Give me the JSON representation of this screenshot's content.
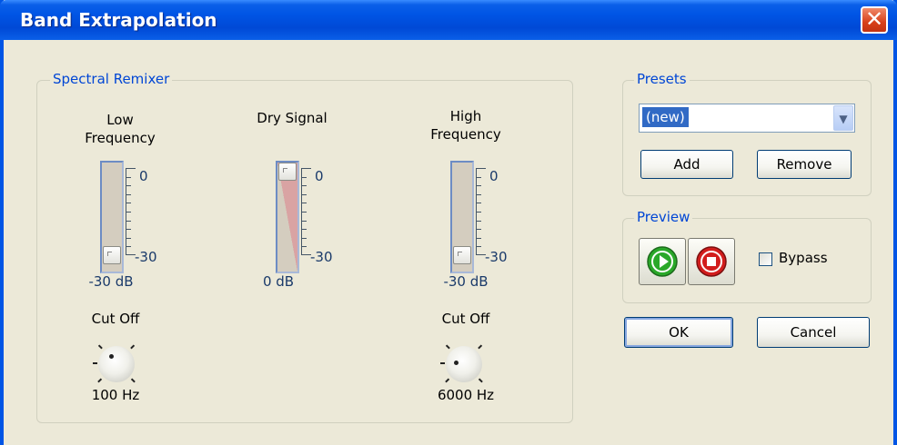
{
  "window": {
    "title": "Band Extrapolation",
    "close_symbol": "✕"
  },
  "spectral_remixer": {
    "legend": "Spectral Remixer",
    "low": {
      "label_line1": "Low",
      "label_line2": "Frequency",
      "scale_top": "0",
      "scale_bottom": "-30",
      "value": "-30 dB",
      "cutoff_label": "Cut Off",
      "cutoff_value": "100 Hz"
    },
    "dry": {
      "label": "Dry Signal",
      "scale_top": "0",
      "scale_bottom": "-30",
      "value": "0 dB"
    },
    "high": {
      "label_line1": "High",
      "label_line2": "Frequency",
      "scale_top": "0",
      "scale_bottom": "-30",
      "value": "-30 dB",
      "cutoff_label": "Cut Off",
      "cutoff_value": "6000 Hz"
    }
  },
  "presets": {
    "legend": "Presets",
    "selected": "(new)",
    "add_label": "Add",
    "remove_label": "Remove"
  },
  "preview": {
    "legend": "Preview",
    "bypass_label": "Bypass",
    "bypass_checked": false
  },
  "buttons": {
    "ok_label": "OK",
    "cancel_label": "Cancel"
  },
  "colors": {
    "title_bar": "#0055e5",
    "accent_text": "#0046d5",
    "close_button": "#d8401a",
    "play_green": "#2aa829",
    "stop_red": "#d21d1d",
    "selection": "#316ac5"
  }
}
